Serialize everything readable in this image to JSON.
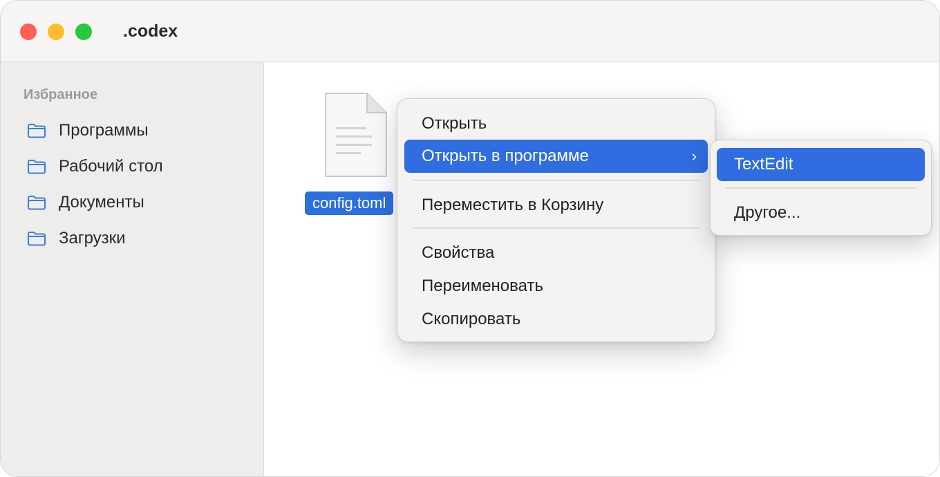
{
  "window": {
    "title": ".codex"
  },
  "sidebar": {
    "heading": "Избранное",
    "items": [
      {
        "label": "Программы",
        "icon": "folder-icon"
      },
      {
        "label": "Рабочий стол",
        "icon": "folder-icon"
      },
      {
        "label": "Документы",
        "icon": "folder-icon"
      },
      {
        "label": "Загрузки",
        "icon": "folder-icon"
      }
    ]
  },
  "file": {
    "name": "config.toml",
    "icon": "document-icon",
    "selected": true
  },
  "context_menu": {
    "items": [
      {
        "label": "Открыть"
      },
      {
        "label": "Открыть в программе",
        "has_submenu": true,
        "chevron": "›",
        "highlighted": true
      },
      {
        "label": "Переместить в Корзину"
      },
      {
        "label": "Свойства"
      },
      {
        "label": "Переименовать"
      },
      {
        "label": "Скопировать"
      }
    ]
  },
  "submenu": {
    "items": [
      {
        "label": "TextEdit",
        "highlighted": true
      },
      {
        "label": "Другое..."
      }
    ]
  },
  "colors": {
    "accent": "#2f6de0",
    "sidebar_bg": "#ededec",
    "titlebar_bg": "#f6f5f4",
    "folder_icon": "#3b7be6",
    "traffic_red": "#ff5f57",
    "traffic_yellow": "#febc2e",
    "traffic_green": "#28c840"
  }
}
